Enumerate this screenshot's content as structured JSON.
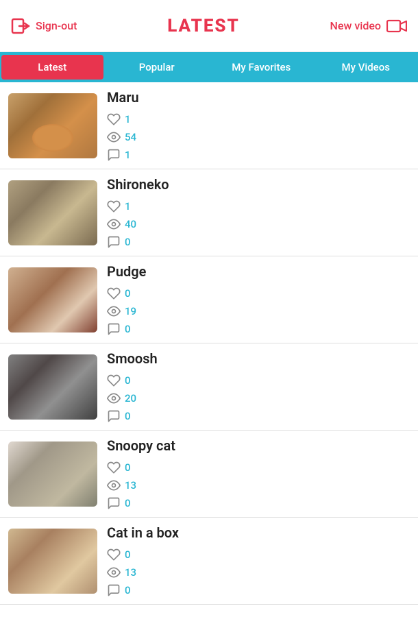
{
  "header": {
    "sign_out_label": "Sign-out",
    "title": "LATEST",
    "new_video_label": "New video"
  },
  "tabs": [
    {
      "id": "latest",
      "label": "Latest",
      "active": true
    },
    {
      "id": "popular",
      "label": "Popular",
      "active": false
    },
    {
      "id": "my-favorites",
      "label": "My Favorites",
      "active": false
    },
    {
      "id": "my-videos",
      "label": "My Videos",
      "active": false
    }
  ],
  "videos": [
    {
      "id": "maru",
      "title": "Maru",
      "likes": "1",
      "views": "54",
      "comments": "1",
      "thumb_class": "thumb-maru"
    },
    {
      "id": "shironeko",
      "title": "Shironeko",
      "likes": "1",
      "views": "40",
      "comments": "0",
      "thumb_class": "thumb-shironeko"
    },
    {
      "id": "pudge",
      "title": "Pudge",
      "likes": "0",
      "views": "19",
      "comments": "0",
      "thumb_class": "thumb-pudge"
    },
    {
      "id": "smoosh",
      "title": "Smoosh",
      "likes": "0",
      "views": "20",
      "comments": "0",
      "thumb_class": "thumb-smoosh"
    },
    {
      "id": "snoopy-cat",
      "title": "Snoopy cat",
      "likes": "0",
      "views": "13",
      "comments": "0",
      "thumb_class": "thumb-snoopy"
    },
    {
      "id": "cat-in-a-box",
      "title": "Cat in a box",
      "likes": "0",
      "views": "13",
      "comments": "0",
      "thumb_class": "thumb-catbox"
    }
  ]
}
